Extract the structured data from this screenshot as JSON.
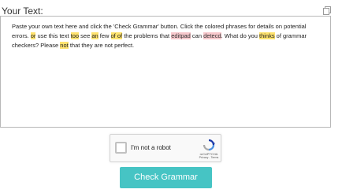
{
  "editor": {
    "label": "Your Text:",
    "copy_icon": "copy-icon",
    "segments": [
      {
        "text": "Paste your own text here and click the 'Check Grammar' button. Click the colored phrases for details on potential errors. ",
        "hl": ""
      },
      {
        "text": "or",
        "hl": "y"
      },
      {
        "text": " use this text ",
        "hl": ""
      },
      {
        "text": "too",
        "hl": "y"
      },
      {
        "text": " see ",
        "hl": ""
      },
      {
        "text": "an",
        "hl": "y"
      },
      {
        "text": " few ",
        "hl": ""
      },
      {
        "text": "of of",
        "hl": "y"
      },
      {
        "text": " the problems that ",
        "hl": ""
      },
      {
        "text": "editpad",
        "hl": "r"
      },
      {
        "text": " can ",
        "hl": ""
      },
      {
        "text": "detecd",
        "hl": "r"
      },
      {
        "text": ". What do you ",
        "hl": ""
      },
      {
        "text": "thinks",
        "hl": "y"
      },
      {
        "text": " of grammar checkers? Please ",
        "hl": ""
      },
      {
        "text": "not",
        "hl": "y"
      },
      {
        "text": " that they are not perfect.",
        "hl": ""
      }
    ]
  },
  "captcha": {
    "label": "I'm not a robot",
    "brand": "reCAPTCHA",
    "terms": "Privacy - Terms",
    "checked": false
  },
  "actions": {
    "check_label": "Check Grammar"
  },
  "colors": {
    "accent": "#46c4c4",
    "highlight_yellow": "#ffe36e",
    "highlight_red": "#f7c8cc"
  }
}
